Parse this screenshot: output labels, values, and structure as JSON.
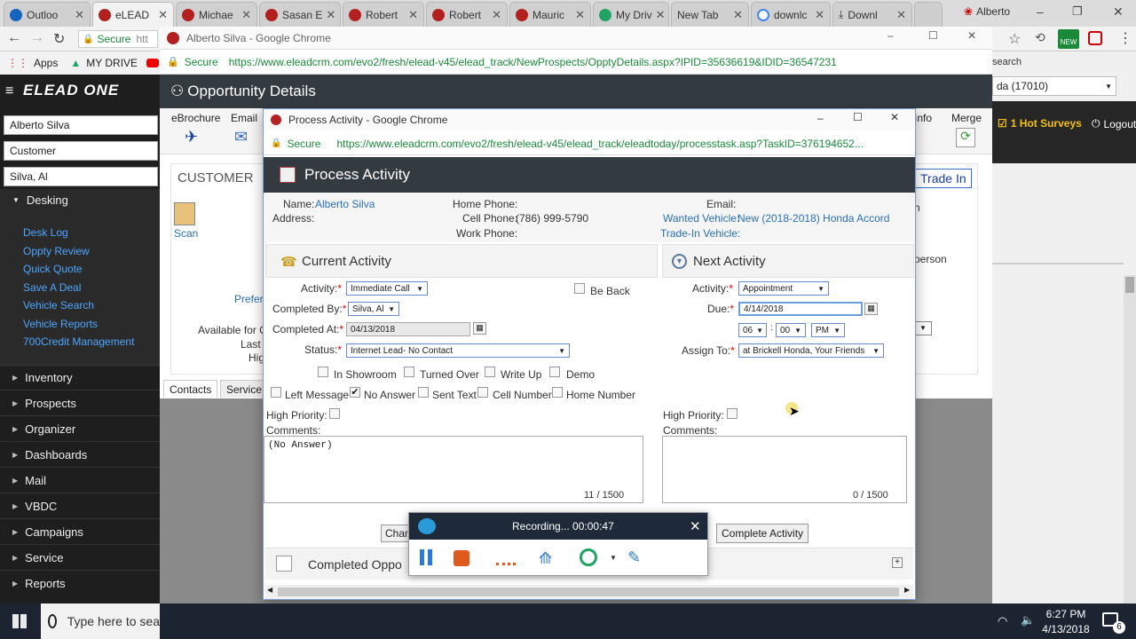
{
  "browser_tabs": [
    {
      "label": "Outloo"
    },
    {
      "label": "eLEAD"
    },
    {
      "label": "Michae"
    },
    {
      "label": "Sasan E"
    },
    {
      "label": "Robert"
    },
    {
      "label": "Robert"
    },
    {
      "label": "Mauric"
    },
    {
      "label": "My Driv"
    },
    {
      "label": "New Tab"
    },
    {
      "label": "downlc"
    },
    {
      "label": "Downl"
    }
  ],
  "profile_name": "Alberto",
  "outer_toolbar": {
    "secure": "Secure",
    "url_fragment": "htt"
  },
  "bookmarks": {
    "apps": "Apps",
    "drive": "MY DRIVE"
  },
  "right_pane": {
    "search": "search",
    "location": "da (17010)",
    "hot_surveys": "1 Hot Surveys",
    "logout": "Logout",
    "person": "person",
    "n_label": "n"
  },
  "sidebar": {
    "logo": "ELEAD ONE",
    "name_input": "Alberto Silva",
    "type_input": "Customer",
    "search_input": "Silva, Al",
    "desking": "Desking",
    "links": [
      "Desk Log",
      "Oppty Review",
      "Quick Quote",
      "Save A Deal",
      "Vehicle Search",
      "Vehicle Reports",
      "700Credit Management"
    ],
    "sections": [
      "Inventory",
      "Prospects",
      "Organizer",
      "Dashboards",
      "Mail",
      "VBDC",
      "Campaigns",
      "Service",
      "Reports"
    ]
  },
  "bg_window": {
    "title": "Alberto Silva - Google Chrome",
    "secure": "Secure",
    "url": "https://www.eleadcrm.com/evo2/fresh/elead-v45/elead_track/NewProspects/OpptyDetails.aspx?IPID=35636619&IDID=36547231",
    "page_title": "Opportunity Details",
    "tools": [
      "eBrochure",
      "Email",
      "Info",
      "Merge"
    ],
    "customer_header": "CUSTOMER",
    "scan": "Scan",
    "trade_in": "Trade In",
    "prefer": "Prefer",
    "available": "Available for C",
    "last": "Last",
    "hig": "Hig",
    "tabs": [
      "Contacts",
      "Service"
    ]
  },
  "modal": {
    "chrome_title": "Process Activity - Google Chrome",
    "secure": "Secure",
    "url": "https://www.eleadcrm.com/evo2/fresh/elead-v45/elead_track/eleadtoday/processtask.asp?TaskID=376194652...",
    "title": "Process Activity",
    "info": {
      "name_label": "Name:",
      "name": "Alberto Silva",
      "address_label": "Address:",
      "home_phone_label": "Home Phone:",
      "cell_phone_label": "Cell Phone:",
      "cell_phone": "(786) 999-5790",
      "work_phone_label": "Work Phone:",
      "email_label": "Email:",
      "wanted_label": "Wanted Vehicle:",
      "wanted": "New (2018-2018) Honda Accord",
      "tradein_label": "Trade-In Vehicle:"
    },
    "current": {
      "header": "Current Activity",
      "activity_label": "Activity:",
      "activity": "Immediate Call",
      "be_back": "Be Back",
      "completed_by_label": "Completed By:",
      "completed_by": "Silva, Al",
      "completed_at_label": "Completed At:",
      "completed_at": "04/13/2018",
      "status_label": "Status:",
      "status": "Internet Lead- No Contact",
      "checks_row1": [
        "In Showroom",
        "Turned Over",
        "Write Up",
        "Demo"
      ],
      "checks_row2": [
        "Left Message",
        "No Answer",
        "Sent Text",
        "Cell Number",
        "Home Number"
      ],
      "checked": "No Answer",
      "high_priority": "High Priority:",
      "comments_label": "Comments:",
      "comments": "(No Answer)",
      "counter": "11 / 1500"
    },
    "next": {
      "header": "Next Activity",
      "activity_label": "Activity:",
      "activity": "Appointment",
      "due_label": "Due:",
      "due": "4/14/2018",
      "hour": "06",
      "minute": "00",
      "ampm": "PM",
      "assign_label": "Assign To:",
      "assign": "at Brickell Honda, Your Friends",
      "high_priority": "High Priority:",
      "comments_label": "Comments:",
      "counter": "0 / 1500"
    },
    "buttons": {
      "change": "Chan",
      "complete": "Complete Activity"
    },
    "completed_section": "Completed Oppo"
  },
  "recorder": {
    "status": "Recording... 00:00:47"
  },
  "taskbar": {
    "search": "Type here to sea",
    "time": "6:27 PM",
    "date": "4/13/2018",
    "notif": "6"
  },
  "colors": {
    "accent": "#2a6fb8",
    "header_dark": "#333a40",
    "required": "#d00000"
  }
}
